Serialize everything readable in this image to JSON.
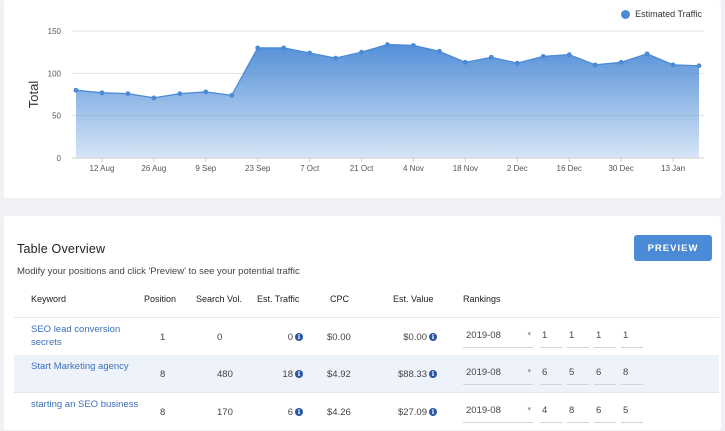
{
  "chart_data": {
    "type": "area",
    "legend": "Estimated Traffic",
    "ylabel": "Total",
    "ylim": [
      0,
      150
    ],
    "yticks": [
      0,
      50,
      100,
      150
    ],
    "x_tick_labels": [
      "12 Aug",
      "26 Aug",
      "9 Sep",
      "23 Sep",
      "7 Oct",
      "21 Oct",
      "4 Nov",
      "18 Nov",
      "2 Dec",
      "16 Dec",
      "30 Dec",
      "13 Jan"
    ],
    "values": [
      80,
      77,
      76,
      71,
      76,
      78,
      74,
      130,
      130,
      124,
      118,
      125,
      134,
      133,
      126,
      113,
      119,
      112,
      120,
      122,
      110,
      113,
      123,
      110,
      109
    ],
    "color": "#4a8ad6"
  },
  "table": {
    "title": "Table Overview",
    "subtitle": "Modify your positions and click 'Preview' to see your potential traffic",
    "preview_label": "PREVIEW",
    "headers": [
      "Keyword",
      "Position",
      "Search Vol.",
      "Est. Traffic",
      "CPC",
      "Est. Value",
      "Rankings"
    ],
    "rows": [
      {
        "keyword": "SEO lead conversion secrets",
        "position": "1",
        "search_vol": "0",
        "est_traffic": "0",
        "cpc": "$0.00",
        "est_value": "$0.00",
        "month": "2019-08",
        "rankings": [
          "1",
          "1",
          "1",
          "1"
        ]
      },
      {
        "keyword": "Start Marketing agency",
        "position": "8",
        "search_vol": "480",
        "est_traffic": "18",
        "cpc": "$4.92",
        "est_value": "$88.33",
        "month": "2019-08",
        "rankings": [
          "6",
          "5",
          "6",
          "8"
        ]
      },
      {
        "keyword": "starting an SEO business",
        "position": "8",
        "search_vol": "170",
        "est_traffic": "6",
        "cpc": "$4.26",
        "est_value": "$27.09",
        "month": "2019-08",
        "rankings": [
          "4",
          "8",
          "6",
          "5"
        ]
      }
    ]
  },
  "icons": {
    "info": "info-icon",
    "caret": "caret-down-icon"
  }
}
